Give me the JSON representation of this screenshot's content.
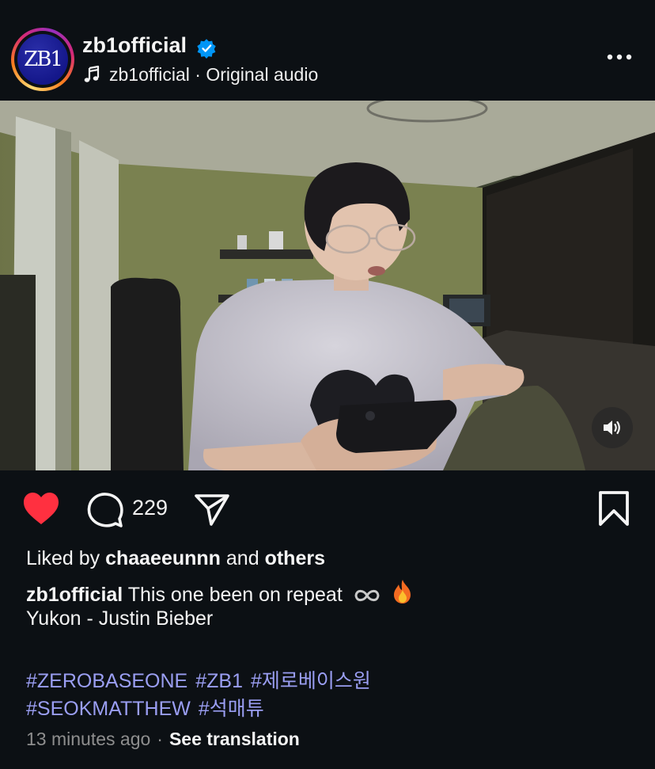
{
  "post": {
    "username": "zb1official",
    "avatar_text": "ZB1",
    "audio_owner": "zb1official",
    "audio_separator": " · ",
    "audio_title": "Original audio",
    "comment_count": "229",
    "liked_by_prefix": "Liked by",
    "liked_by_user": "chaaeeunnn",
    "liked_by_and": "and",
    "liked_by_others": "others",
    "caption_username": "zb1official",
    "caption_text": "This one been on repeat",
    "caption_line2": "Yukon - Justin Bieber",
    "hashtags_line1": [
      "#ZEROBASEONE",
      "#ZB1",
      "#제로베이스원"
    ],
    "hashtags_line2": [
      "#SEOKMATTHEW",
      "#석매튜"
    ],
    "time_ago": "13 minutes ago",
    "meta_separator": "·",
    "see_translation": "See translation"
  },
  "icons": {
    "verified": "verified-badge-icon",
    "music": "music-note-icon",
    "more": "more-options-icon",
    "sound": "speaker-icon",
    "like": "heart-icon",
    "comment": "comment-icon",
    "share": "send-icon",
    "save": "bookmark-icon",
    "infinity": "infinity-emoji",
    "fire": "fire-emoji"
  },
  "colors": {
    "background": "#0c1014",
    "like_red": "#ff3040",
    "verified_blue": "#0095f6",
    "hashtag": "#9a9ef2",
    "muted": "#8e8e8e"
  },
  "state": {
    "liked": true,
    "muted_video": false
  }
}
